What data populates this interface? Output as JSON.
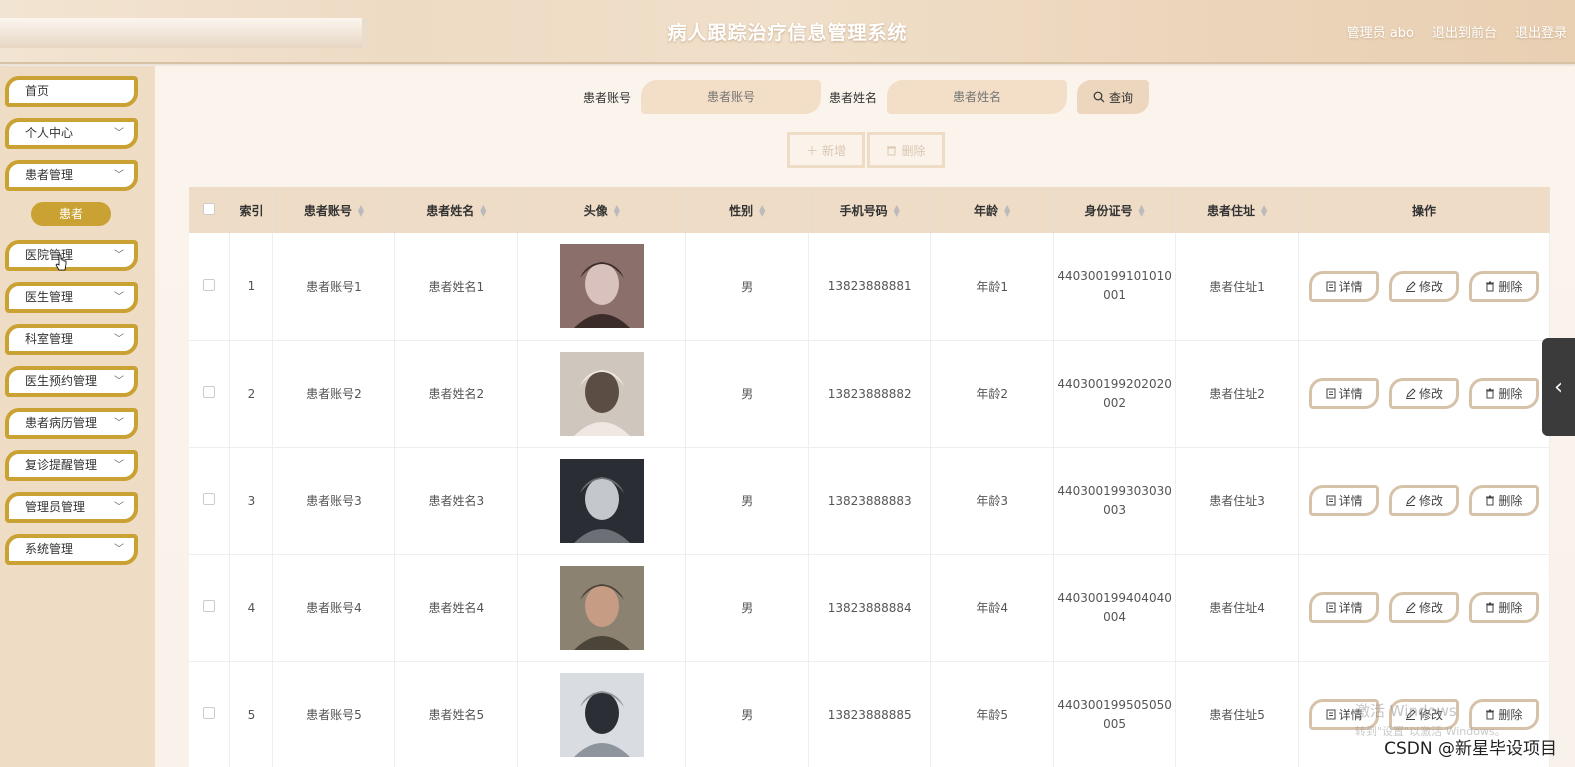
{
  "header": {
    "title": "病人跟踪治疗信息管理系统",
    "user": "管理员 abo",
    "back_label": "退出到前台",
    "logout_label": "退出登录"
  },
  "sidebar": {
    "items": [
      {
        "label": "首页",
        "has_chevron": false
      },
      {
        "label": "个人中心",
        "has_chevron": true
      },
      {
        "label": "患者管理",
        "has_chevron": true
      },
      {
        "label": "医院管理",
        "has_chevron": true
      },
      {
        "label": "医生管理",
        "has_chevron": true
      },
      {
        "label": "科室管理",
        "has_chevron": true
      },
      {
        "label": "医生预约管理",
        "has_chevron": true
      },
      {
        "label": "患者病历管理",
        "has_chevron": true
      },
      {
        "label": "复诊提醒管理",
        "has_chevron": true
      },
      {
        "label": "管理员管理",
        "has_chevron": true
      },
      {
        "label": "系统管理",
        "has_chevron": true
      }
    ],
    "active_sub": "患者"
  },
  "search": {
    "account_label": "患者账号",
    "account_placeholder": "患者账号",
    "name_label": "患者姓名",
    "name_placeholder": "患者姓名",
    "query_label": "查询"
  },
  "actions": {
    "add_label": "新增",
    "delete_label": "删除"
  },
  "table": {
    "columns": [
      "索引",
      "患者账号",
      "患者姓名",
      "头像",
      "性别",
      "手机号码",
      "年龄",
      "身份证号",
      "患者住址",
      "操作"
    ],
    "rows": [
      {
        "index": "1",
        "account": "患者账号1",
        "name": "患者姓名1",
        "gender": "男",
        "phone": "13823888881",
        "age": "年龄1",
        "id_a": "440300199101010",
        "id_b": "001",
        "address": "患者住址1"
      },
      {
        "index": "2",
        "account": "患者账号2",
        "name": "患者姓名2",
        "gender": "男",
        "phone": "13823888882",
        "age": "年龄2",
        "id_a": "440300199202020",
        "id_b": "002",
        "address": "患者住址2"
      },
      {
        "index": "3",
        "account": "患者账号3",
        "name": "患者姓名3",
        "gender": "男",
        "phone": "13823888883",
        "age": "年龄3",
        "id_a": "440300199303030",
        "id_b": "003",
        "address": "患者住址3"
      },
      {
        "index": "4",
        "account": "患者账号4",
        "name": "患者姓名4",
        "gender": "男",
        "phone": "13823888884",
        "age": "年龄4",
        "id_a": "440300199404040",
        "id_b": "004",
        "address": "患者住址4"
      },
      {
        "index": "5",
        "account": "患者账号5",
        "name": "患者姓名5",
        "gender": "男",
        "phone": "13823888885",
        "age": "年龄5",
        "id_a": "440300199505050",
        "id_b": "005",
        "address": "患者住址5"
      }
    ],
    "op_labels": {
      "detail": "详情",
      "edit": "修改",
      "delete": "删除"
    }
  },
  "overlay": {
    "watermark_line1": "激活 Windows",
    "watermark_line2": "转到\"设置\"以激活 Windows。",
    "csdn": "CSDN @新星毕设项目"
  },
  "colors": {
    "accent": "#c9a233",
    "header_bg": "#eedbc4",
    "table_head": "#eedcc7"
  }
}
